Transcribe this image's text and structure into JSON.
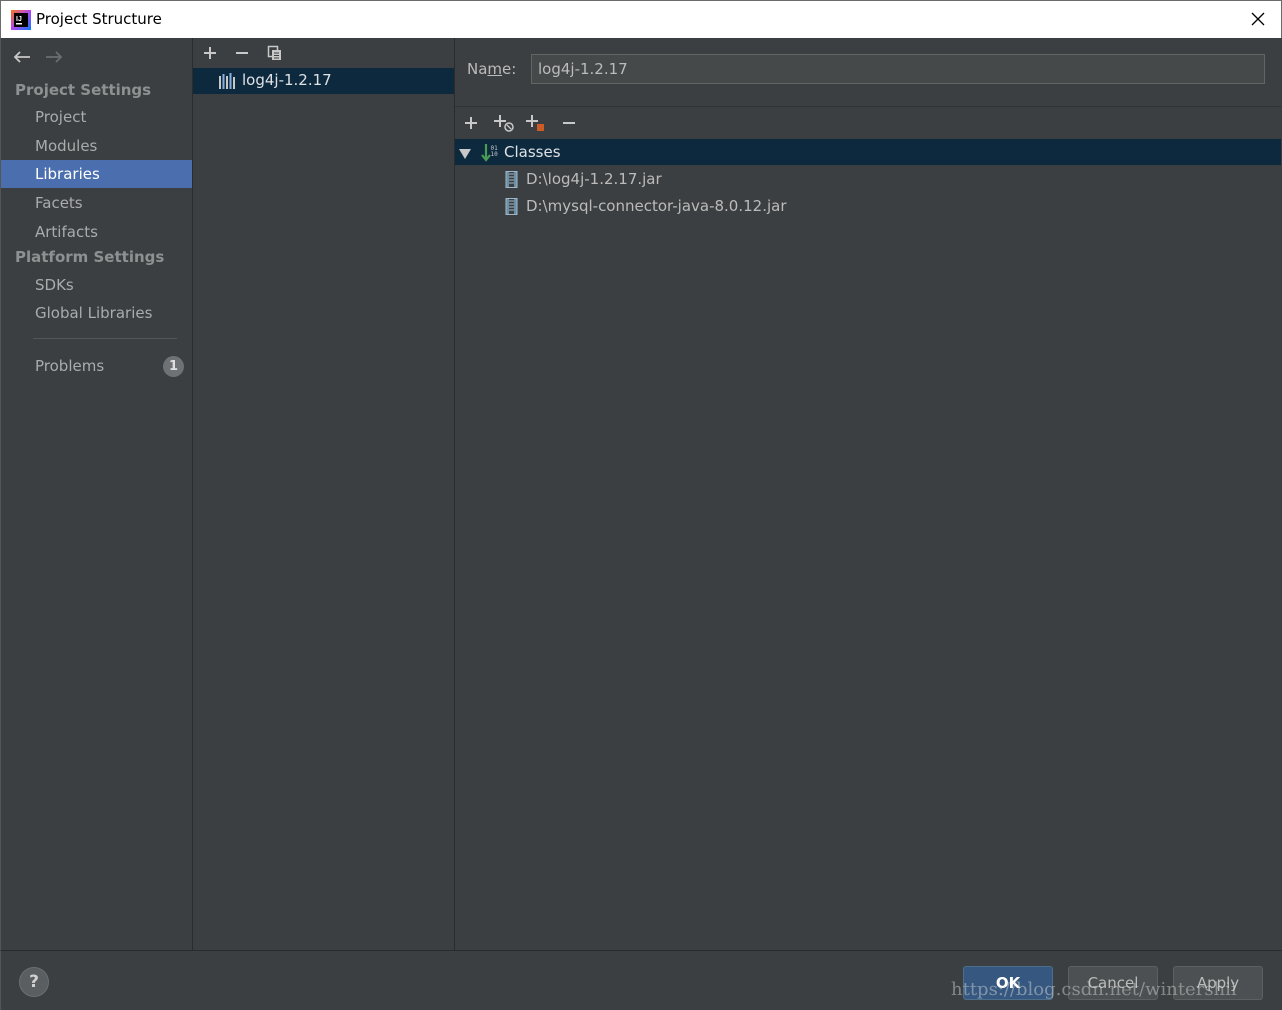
{
  "window": {
    "title": "Project Structure",
    "icon": "intellij-idea-icon",
    "close_icon": "close-icon"
  },
  "sidebar": {
    "back_icon": "arrow-left-icon",
    "forward_icon": "arrow-right-icon",
    "project_settings_heading": "Project Settings",
    "project_items": [
      {
        "label": "Project",
        "selected": false
      },
      {
        "label": "Modules",
        "selected": false
      },
      {
        "label": "Libraries",
        "selected": true
      },
      {
        "label": "Facets",
        "selected": false
      },
      {
        "label": "Artifacts",
        "selected": false
      }
    ],
    "platform_settings_heading": "Platform Settings",
    "platform_items": [
      {
        "label": "SDKs"
      },
      {
        "label": "Global Libraries"
      }
    ],
    "problems": {
      "label": "Problems",
      "count": "1"
    }
  },
  "libraries_panel": {
    "toolbar": [
      "add-icon",
      "remove-icon",
      "copy-icon"
    ],
    "items": [
      {
        "label": "log4j-1.2.17",
        "icon": "library-icon",
        "selected": true
      }
    ]
  },
  "detail": {
    "name_label_pre": "Na",
    "name_label_mnemonic": "m",
    "name_label_post": "e:",
    "name_value": "log4j-1.2.17",
    "toolbar": [
      "add-icon",
      "add-with-settings-icon",
      "add-jar-icon",
      "remove-icon"
    ],
    "tree": {
      "root_label": "Classes",
      "root_icon": "classes-icon",
      "expanded": true,
      "children": [
        {
          "label": "D:\\log4j-1.2.17.jar",
          "icon": "jar-icon"
        },
        {
          "label": "D:\\mysql-connector-java-8.0.12.jar",
          "icon": "jar-icon"
        }
      ]
    }
  },
  "footer": {
    "help_label": "?",
    "ok_label": "OK",
    "cancel_label": "Cancel",
    "apply_label": "Apply",
    "watermark": "https://blog.csdn.net/wintershii"
  },
  "colors": {
    "background": "#3c3f41",
    "selection_sidebar": "#4b6eaf",
    "selection_tree": "#0d293e",
    "primary_button": "#365880"
  }
}
